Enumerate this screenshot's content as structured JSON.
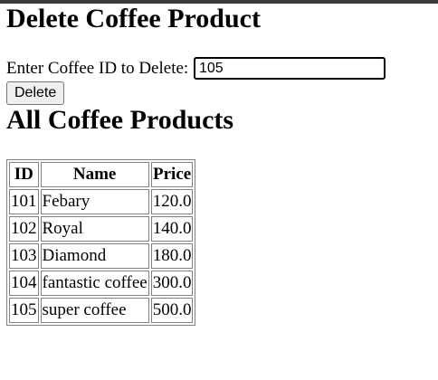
{
  "headings": {
    "delete": "Delete Coffee Product",
    "all": "All Coffee Products"
  },
  "form": {
    "label": "Enter Coffee ID to Delete:",
    "input_value": "105",
    "button_label": "Delete"
  },
  "table": {
    "headers": [
      "ID",
      "Name",
      "Price"
    ],
    "rows": [
      [
        "101",
        "Febary",
        "120.0"
      ],
      [
        "102",
        "Royal",
        "140.0"
      ],
      [
        "103",
        "Diamond",
        "180.0"
      ],
      [
        "104",
        "fantastic coffee",
        "300.0"
      ],
      [
        "105",
        "super coffee",
        "500.0"
      ]
    ]
  }
}
